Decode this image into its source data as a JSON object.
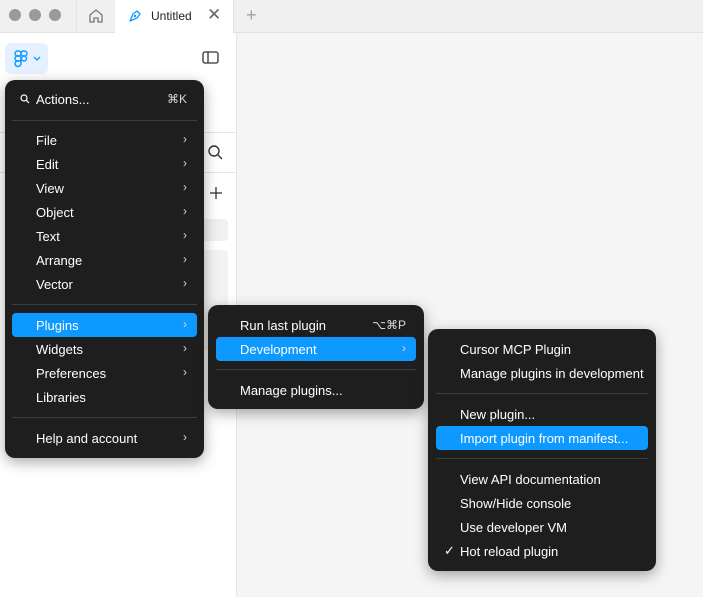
{
  "tab": {
    "title": "Untitled",
    "close_glyph": "✕",
    "new_tab_glyph": "+"
  },
  "main_menu": {
    "search_label": "Actions...",
    "search_shortcut": "⌘K",
    "items": [
      {
        "label": "File",
        "submenu": true
      },
      {
        "label": "Edit",
        "submenu": true
      },
      {
        "label": "View",
        "submenu": true
      },
      {
        "label": "Object",
        "submenu": true
      },
      {
        "label": "Text",
        "submenu": true
      },
      {
        "label": "Arrange",
        "submenu": true
      },
      {
        "label": "Vector",
        "submenu": true
      },
      {
        "label": "Plugins",
        "submenu": true,
        "active": true
      },
      {
        "label": "Widgets",
        "submenu": true
      },
      {
        "label": "Preferences",
        "submenu": true
      },
      {
        "label": "Libraries",
        "submenu": false
      },
      {
        "label": "Help and account",
        "submenu": true
      }
    ]
  },
  "plugins_menu": {
    "items": [
      {
        "label": "Run last plugin",
        "shortcut": "⌥⌘P"
      },
      {
        "label": "Development",
        "submenu": true,
        "active": true
      },
      {
        "label": "Manage plugins..."
      }
    ]
  },
  "dev_menu": {
    "items": [
      {
        "label": "Cursor MCP Plugin"
      },
      {
        "label": "Manage plugins in development"
      },
      {
        "label": "New plugin..."
      },
      {
        "label": "Import plugin from manifest...",
        "active": true
      },
      {
        "label": "View API documentation"
      },
      {
        "label": "Show/Hide console"
      },
      {
        "label": "Use developer VM"
      },
      {
        "label": "Hot reload plugin",
        "checked": true
      }
    ]
  },
  "glyphs": {
    "arrow": "›",
    "check": "✓"
  },
  "colors": {
    "accent": "#0d99ff",
    "menu_bg": "#1e1e1e"
  }
}
